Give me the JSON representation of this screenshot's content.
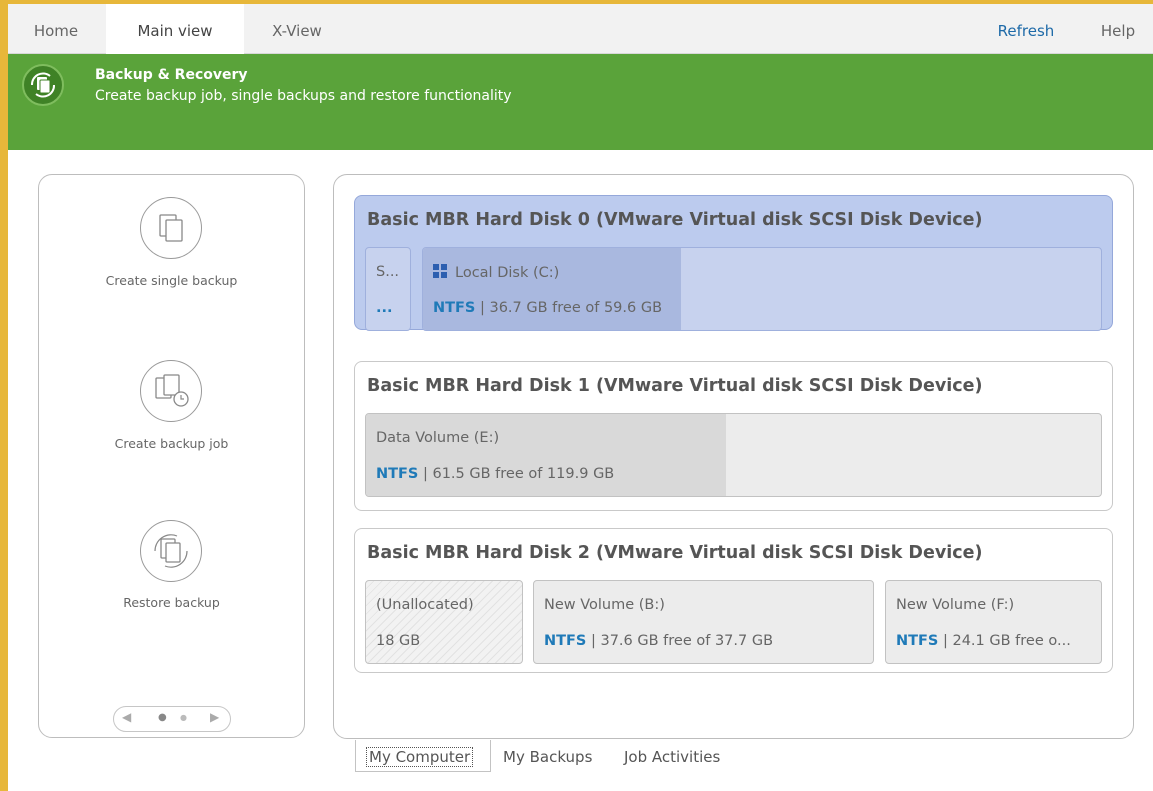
{
  "topnav": {
    "tabs": [
      {
        "label": "Home"
      },
      {
        "label": "Main view"
      },
      {
        "label": "X-View"
      }
    ],
    "refresh": "Refresh",
    "help": "Help"
  },
  "banner": {
    "title": "Backup & Recovery",
    "subtitle": "Create backup job, single backups and restore functionality",
    "icon": "backup-recovery-icon"
  },
  "actions": [
    {
      "label": "Create single backup",
      "icon": "single-backup-icon"
    },
    {
      "label": "Create backup job",
      "icon": "backup-job-icon"
    },
    {
      "label": "Restore backup",
      "icon": "restore-backup-icon"
    }
  ],
  "pager": {
    "prev": "◀",
    "next": "▶",
    "pages": 2,
    "current": 1
  },
  "disks": [
    {
      "title": "Basic MBR Hard Disk 0 (VMware Virtual disk SCSI Disk Device)",
      "selected": true,
      "partitions": [
        {
          "name": "S...",
          "info_fs": "",
          "info_rest": "...",
          "type": "system"
        },
        {
          "name": "Local Disk (C:)",
          "info_fs": "NTFS",
          "info_rest": " | 36.7 GB free of 59.6 GB",
          "used_fraction": 0.38,
          "icon": "windows-icon"
        }
      ]
    },
    {
      "title": "Basic MBR Hard Disk 1 (VMware Virtual disk SCSI Disk Device)",
      "selected": false,
      "partitions": [
        {
          "name": "Data Volume (E:)",
          "info_fs": "NTFS",
          "info_rest": " | 61.5 GB free of 119.9 GB",
          "used_fraction": 0.49
        }
      ]
    },
    {
      "title": "Basic MBR Hard Disk 2 (VMware Virtual disk SCSI Disk Device)",
      "selected": false,
      "partitions": [
        {
          "name": "(Unallocated)",
          "info_fs": "",
          "info_rest": "18 GB",
          "type": "unallocated"
        },
        {
          "name": "New Volume (B:)",
          "info_fs": "NTFS",
          "info_rest": " | 37.6 GB free of 37.7 GB",
          "used_fraction": 0.0
        },
        {
          "name": "New Volume (F:)",
          "info_fs": "NTFS",
          "info_rest": " | 24.1 GB free o...",
          "used_fraction": 0.0
        }
      ]
    }
  ],
  "bottom_tabs": [
    {
      "label": "My Computer",
      "active": true
    },
    {
      "label": "My Backups"
    },
    {
      "label": "Job Activities"
    }
  ]
}
